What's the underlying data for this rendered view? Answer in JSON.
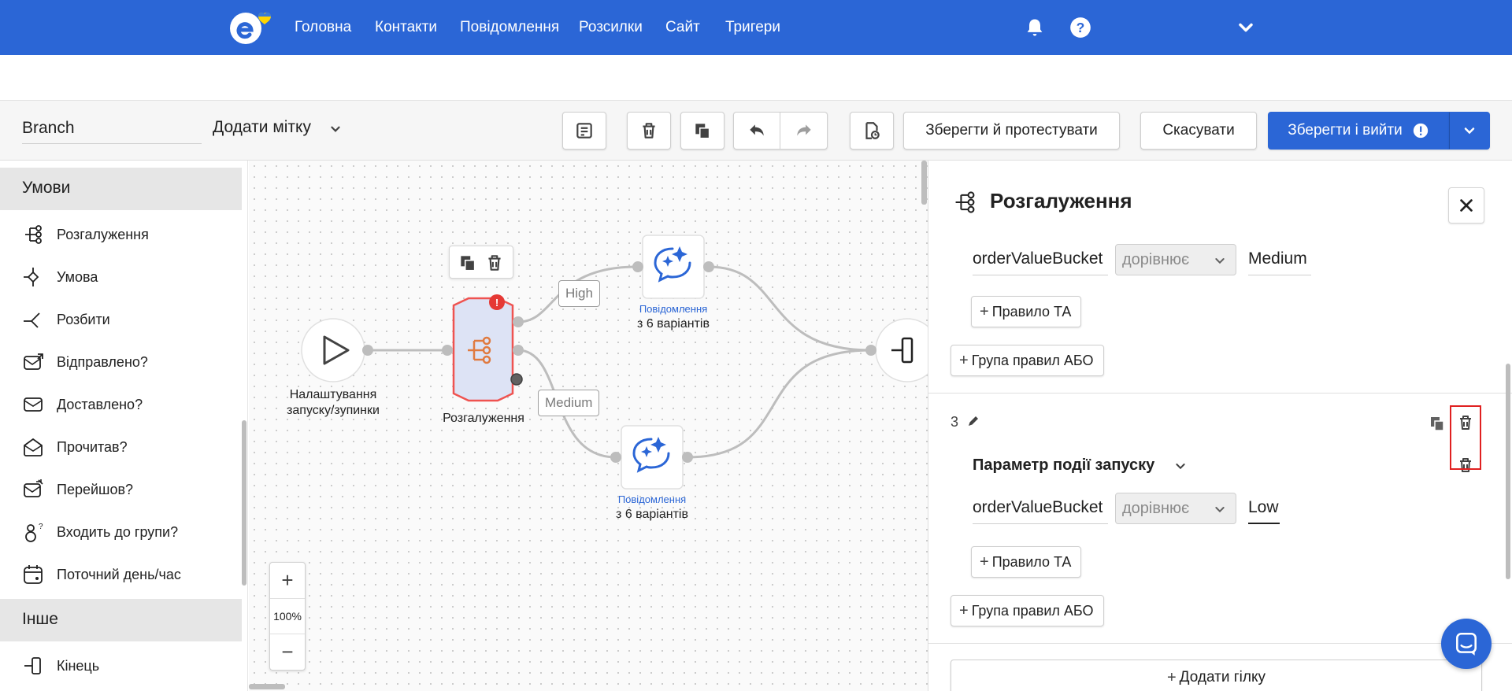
{
  "topnav": {
    "links": [
      "Головна",
      "Контакти",
      "Повідомлення",
      "Розсилки",
      "Сайт",
      "Тригери"
    ],
    "icons": [
      "logo-icon",
      "bell-icon",
      "help-icon",
      "chevron-down-icon"
    ],
    "color": "#2b66d6"
  },
  "toolbar": {
    "flow_name": "Branch",
    "add_tag": "Додати мітку",
    "save_test": "Зберегти й протестувати",
    "cancel": "Скасувати",
    "save_exit": "Зберегти і вийти",
    "icons": [
      "note-icon",
      "trash-icon",
      "copy-icon",
      "undo-icon",
      "redo-icon",
      "history-icon",
      "chevron-down-icon"
    ]
  },
  "sidebar": {
    "section_conditions": "Умови",
    "items": [
      {
        "label": "Розгалуження",
        "icon": "branch-icon"
      },
      {
        "label": "Умова",
        "icon": "condition-icon"
      },
      {
        "label": "Розбити",
        "icon": "split-icon"
      },
      {
        "label": "Відправлено?",
        "icon": "sent-icon"
      },
      {
        "label": "Доставлено?",
        "icon": "envelope-icon"
      },
      {
        "label": "Прочитав?",
        "icon": "read-icon"
      },
      {
        "label": "Перейшов?",
        "icon": "click-icon"
      },
      {
        "label": "Входить до групи?",
        "icon": "group-icon"
      },
      {
        "label": "Поточний день/час",
        "icon": "calendar-icon"
      }
    ],
    "section_other": "Інше",
    "other_items": [
      {
        "label": "Кінець",
        "icon": "end-icon"
      }
    ]
  },
  "canvas": {
    "start_label_line1": "Налаштування",
    "start_label_line2": "запуску/зупинки",
    "branch_label": "Розгалуження",
    "edge_high": "High",
    "edge_medium": "Medium",
    "message_type": "Повідомлення",
    "message_variants": "з 6 варіантів",
    "zoom_in": "+",
    "zoom_out": "−",
    "zoom_level": "100%",
    "error_badge": "!",
    "accent": "#2b66d6",
    "error_color": "#e53935"
  },
  "panel": {
    "title": "Розгалуження",
    "rule1": {
      "param": "orderValueBucket",
      "op": "дорівнює",
      "value": "Medium"
    },
    "add_and": "Правило ТА",
    "add_or": "Група правил АБО",
    "branch3": {
      "number": "3",
      "group_title": "Параметр події запуску",
      "rule": {
        "param": "orderValueBucket",
        "op": "дорівнює",
        "value": "Low"
      }
    },
    "add_branch": "Додати гілку"
  }
}
